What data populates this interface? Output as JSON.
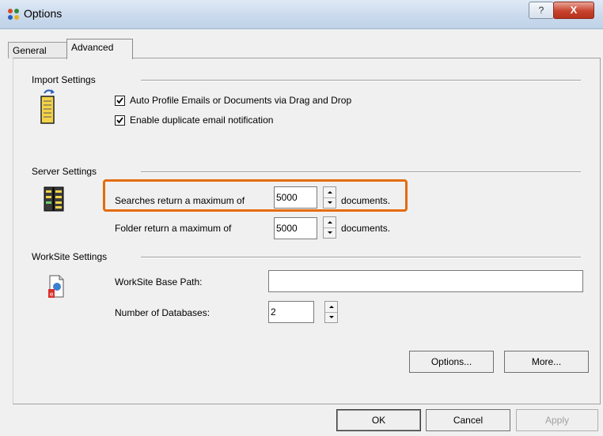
{
  "window": {
    "title": "Options",
    "close_label": "X",
    "help_label": "?"
  },
  "tabs": [
    {
      "label": "General"
    },
    {
      "label": "Advanced"
    }
  ],
  "import_settings": {
    "heading": "Import Settings",
    "auto_profile": "Auto Profile Emails or Documents via Drag and Drop",
    "duplicate_notification": "Enable duplicate email notification"
  },
  "server_settings": {
    "heading": "Server Settings",
    "searches_label": "Searches return a maximum of",
    "searches_value": "5000",
    "searches_unit": "documents.",
    "folder_label": "Folder return a maximum of",
    "folder_value": "5000",
    "folder_unit": "documents."
  },
  "worksite_settings": {
    "heading": "WorkSite Settings",
    "base_path_label": "WorkSite Base Path:",
    "base_path_value": "",
    "databases_label": "Number of Databases:",
    "databases_value": "2"
  },
  "buttons": {
    "options": "Options...",
    "more": "More...",
    "ok": "OK",
    "cancel": "Cancel",
    "apply": "Apply"
  },
  "colors": {
    "highlight": "#e46c0a"
  }
}
